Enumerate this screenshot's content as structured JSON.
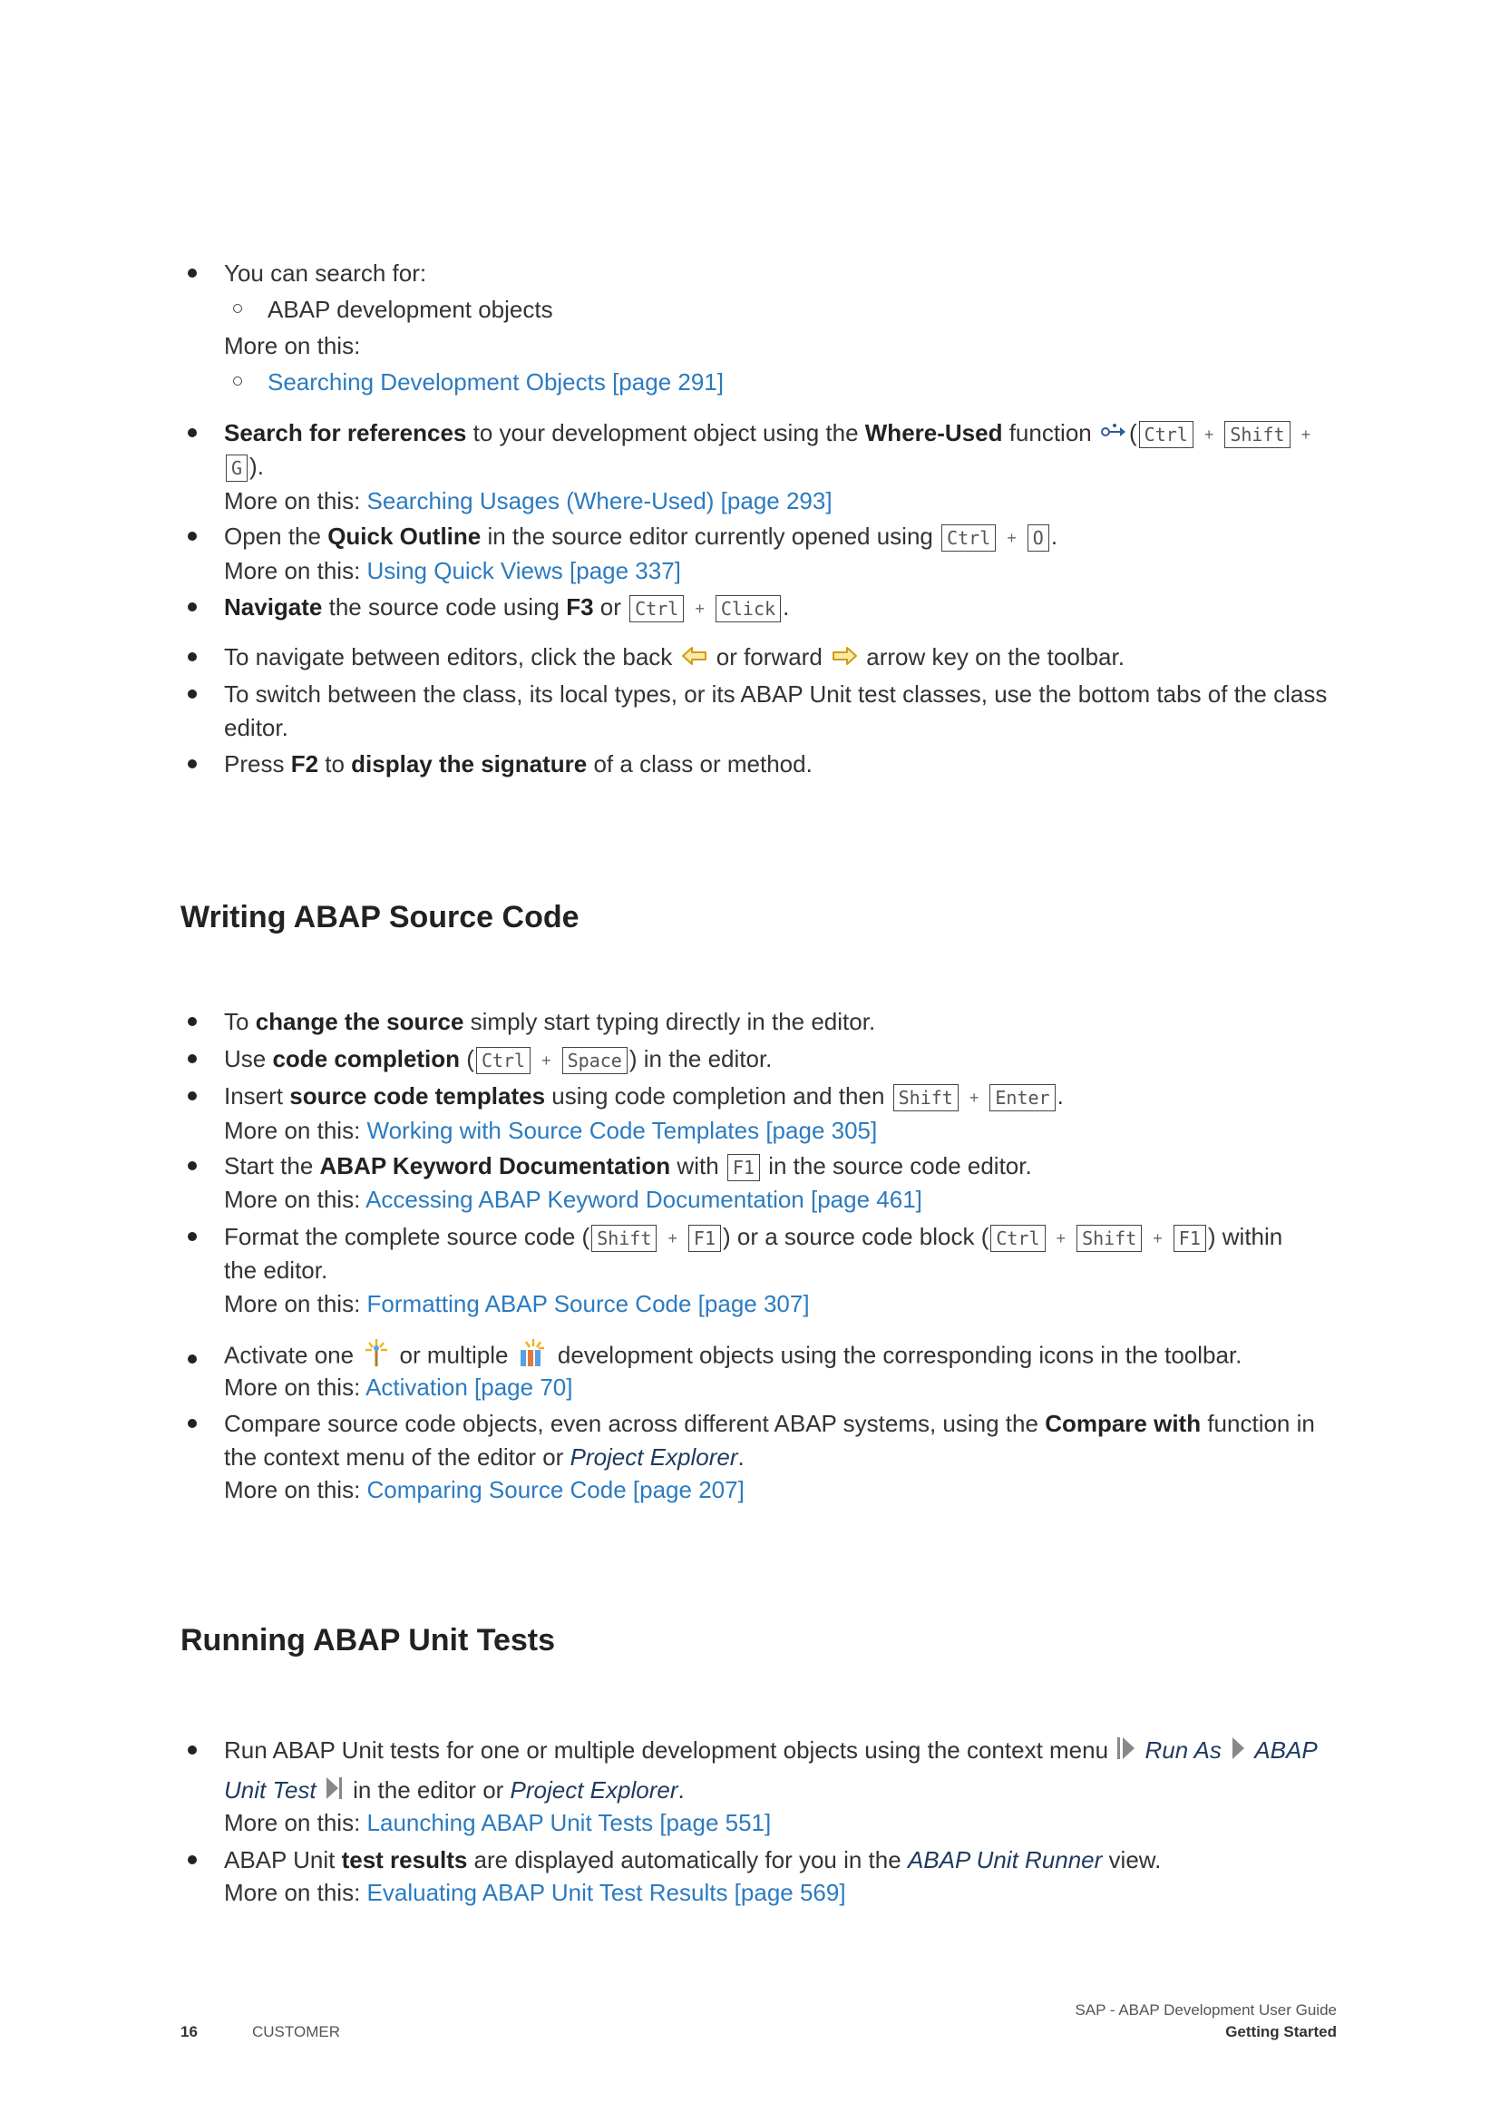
{
  "section1": {
    "search_intro": "You can search for:",
    "search_sub1": "ABAP development objects",
    "more_on_this": "More on this:",
    "search_link": "Searching Development Objects [page 291]",
    "ref_bold": "Search for references",
    "ref_text": " to your development object using the ",
    "ref_bold2": "Where-Used",
    "ref_text2": " function ",
    "ref_link": "Searching Usages (Where-Used) [page 293]",
    "outline_pre": "Open the ",
    "outline_bold": "Quick Outline",
    "outline_text": " in the source editor currently opened using ",
    "outline_link": "Using Quick Views [page 337]",
    "nav_bold": "Navigate",
    "nav_text": " the source code using ",
    "nav_f3": "F3",
    "nav_or": " or ",
    "editors_text1": "To navigate between editors, click the back ",
    "editors_text2": " or forward ",
    "editors_text3": " arrow key on the toolbar.",
    "switch_line1": "To switch between the class, its local types, or its ABAP Unit test classes, use the bottom tabs of the class",
    "switch_line2": "editor.",
    "press_pre": "Press ",
    "press_f2": "F2",
    "press_to": " to ",
    "press_bold": "display the signature",
    "press_text": " of a class or method."
  },
  "section2": {
    "heading": "Writing ABAP Source Code",
    "change_pre": "To ",
    "change_bold": "change the source",
    "change_text": " simply start typing directly in the editor.",
    "use_pre": "Use ",
    "use_bold": "code completion",
    "use_text": " in the editor.",
    "insert_pre": "Insert ",
    "insert_bold": "source code templates",
    "insert_text": " using code completion and then ",
    "insert_link": "Working with Source Code Templates [page 305]",
    "start_pre": "Start the ",
    "start_bold": "ABAP Keyword Documentation",
    "start_with": " with ",
    "start_text": " in the source code editor.",
    "start_link": "Accessing ABAP Keyword Documentation [page 461]",
    "format_pre": "Format the complete source code (",
    "format_mid": ") or a source code block (",
    "format_end": ") within",
    "format_line2": "the editor.",
    "format_link": "Formatting ABAP Source Code [page 307]",
    "activate_pre": "Activate one ",
    "activate_mid": " or multiple ",
    "activate_text": " development objects using the corresponding icons in the toolbar.",
    "activate_link": "Activation [page 70]",
    "compare_pre": "Compare source code objects, even across different ABAP systems, using the ",
    "compare_bold": "Compare with",
    "compare_text": " function in",
    "compare_line2_pre": "the context menu of the editor or ",
    "compare_em": "Project Explorer",
    "compare_link": "Comparing Source Code [page 207]"
  },
  "section3": {
    "heading": "Running ABAP Unit Tests",
    "run_pre": "Run ABAP Unit tests for one or multiple development objects using the context menu ",
    "run_as": "Run As",
    "run_abap": "ABAP",
    "run_unit_test": "Unit Test",
    "run_text2": " in the editor or ",
    "run_em2": "Project Explorer",
    "run_link": "Launching ABAP Unit Tests [page 551]",
    "results_pre": "ABAP Unit ",
    "results_bold": "test results",
    "results_text": " are displayed automatically for you in the ",
    "results_em": "ABAP Unit Runner",
    "results_text2": " view.",
    "results_link": "Evaluating ABAP Unit Test Results [page 569]"
  },
  "keys": {
    "ctrl": "Ctrl",
    "shift": "Shift",
    "g": "G",
    "o": "O",
    "click": "Click",
    "space": "Space",
    "enter": "Enter",
    "f1": "F1",
    "plus": "+"
  },
  "footer": {
    "page_number": "16",
    "classification": "CUSTOMER",
    "doc_title": "SAP - ABAP Development User Guide",
    "chapter": "Getting Started"
  },
  "colors": {
    "link": "#2b7bc0",
    "text": "#333333",
    "heading": "#222222"
  }
}
